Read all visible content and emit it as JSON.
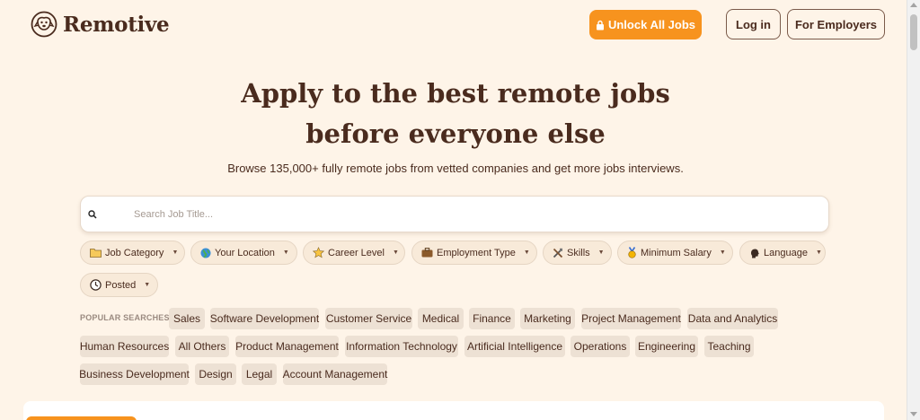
{
  "brand": {
    "name": "Remotive"
  },
  "header": {
    "unlock_label": "Unlock All Jobs",
    "login_label": "Log in",
    "employers_label": "For Employers"
  },
  "hero": {
    "title_line1": "Apply to the best remote jobs",
    "title_line2": "before everyone else",
    "subtitle": "Browse 135,000+ fully remote jobs from vetted companies and get more jobs interviews."
  },
  "search": {
    "placeholder": "Search Job Title..."
  },
  "filters": [
    {
      "label": "Job Category",
      "icon": "folder-icon"
    },
    {
      "label": "Your Location",
      "icon": "globe-icon"
    },
    {
      "label": "Career Level",
      "icon": "star-icon"
    },
    {
      "label": "Employment Type",
      "icon": "briefcase-icon"
    },
    {
      "label": "Skills",
      "icon": "tools-icon"
    },
    {
      "label": "Minimum Salary",
      "icon": "medal-icon"
    },
    {
      "label": "Language",
      "icon": "speaking-head-icon"
    },
    {
      "label": "Posted",
      "icon": "clock-icon"
    }
  ],
  "popular": {
    "label": "POPULAR SEARCHES:",
    "tags": [
      "Sales",
      "Software Development",
      "Customer Service",
      "Medical",
      "Finance",
      "Marketing",
      "Project Management",
      "Data and Analytics",
      "Human Resources",
      "All Others",
      "Product Management",
      "Information Technology",
      "Artificial Intelligence",
      "Operations",
      "Engineering",
      "Teaching",
      "Business Development",
      "Design",
      "Legal",
      "Account Management"
    ]
  },
  "colors": {
    "accent": "#f7931e",
    "text": "#4a2b1e",
    "background": "#fef4e8",
    "tag_bg": "#ede1d4"
  }
}
